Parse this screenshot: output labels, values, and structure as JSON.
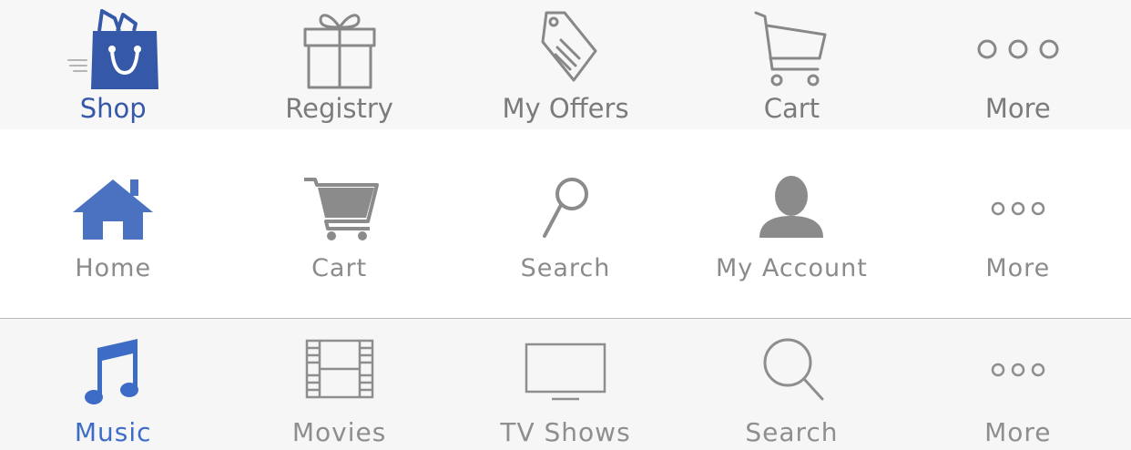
{
  "colors": {
    "active_blue": "#3558a8",
    "inactive_gray": "#7b7b7b"
  },
  "bar_one": {
    "tabs": [
      {
        "label": "Shop",
        "icon": "shopping-bag-icon",
        "active": true
      },
      {
        "label": "Registry",
        "icon": "gift-icon",
        "active": false
      },
      {
        "label": "My Offers",
        "icon": "tag-icon",
        "active": false
      },
      {
        "label": "Cart",
        "icon": "cart-icon",
        "active": false
      },
      {
        "label": "More",
        "icon": "more-dots-icon",
        "active": false
      }
    ]
  },
  "bar_two": {
    "tabs": [
      {
        "label": "Home",
        "icon": "home-icon",
        "active": true
      },
      {
        "label": "Cart",
        "icon": "cart-icon",
        "active": false
      },
      {
        "label": "Search",
        "icon": "search-icon",
        "active": false
      },
      {
        "label": "My Account",
        "icon": "person-icon",
        "active": false
      },
      {
        "label": "More",
        "icon": "more-dots-icon",
        "active": false
      }
    ]
  },
  "bar_three": {
    "tabs": [
      {
        "label": "Music",
        "icon": "music-note-icon",
        "active": true
      },
      {
        "label": "Movies",
        "icon": "film-strip-icon",
        "active": false
      },
      {
        "label": "TV Shows",
        "icon": "tv-icon",
        "active": false
      },
      {
        "label": "Search",
        "icon": "search-icon",
        "active": false
      },
      {
        "label": "More",
        "icon": "more-dots-icon",
        "active": false
      }
    ]
  }
}
